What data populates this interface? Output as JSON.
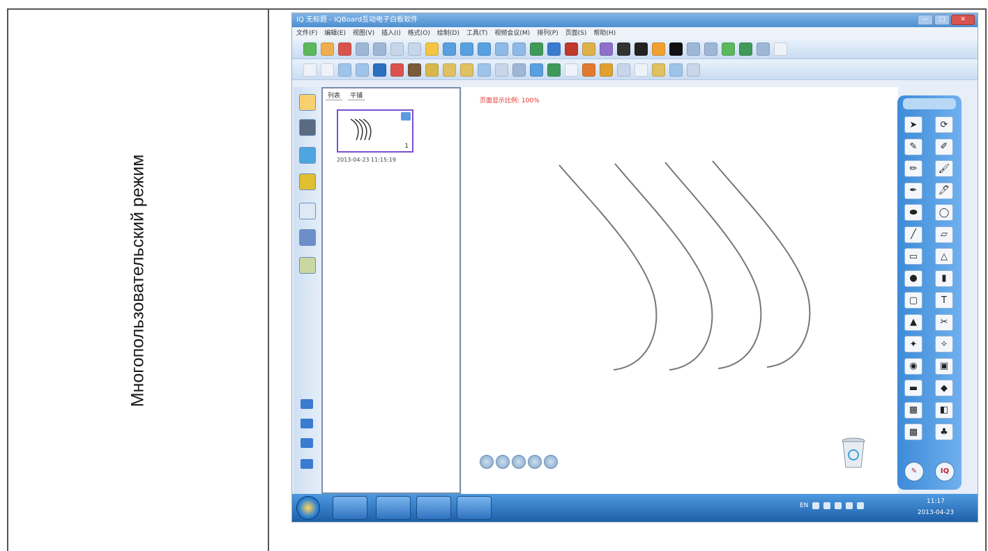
{
  "left_cell": {
    "label": "Многопользовательский режим"
  },
  "app": {
    "title": "IQ 无标题 - IQBoard互动电子白板软件",
    "menu": [
      "文件(F)",
      "编辑(E)",
      "视图(V)",
      "插入(I)",
      "格式(O)",
      "绘制(D)",
      "工具(T)",
      "视频会议(M)",
      "排列(P)",
      "页面(S)",
      "帮助(H)"
    ],
    "window_buttons": [
      "—",
      "□",
      "✕"
    ]
  },
  "pages_panel": {
    "tabs": [
      "列表",
      "平铺"
    ],
    "thumbnail": {
      "page_number": "1",
      "date": "2013-04-23 11:15:19"
    }
  },
  "canvas": {
    "zoom_text": "页面显示比例: 100%"
  },
  "palette": {
    "cells": [
      "➤",
      "⟳",
      "✎",
      "✐",
      "✏",
      "🖌",
      "✒",
      "🖊",
      "⬬",
      "◯",
      "╱",
      "▱",
      "▭",
      "△",
      "●",
      "▮",
      "▢",
      "T",
      "▲",
      "✂",
      "✦",
      "✧",
      "◉",
      "▣",
      "▬",
      "◆",
      "▦",
      "◧",
      "▩",
      "♣"
    ],
    "bottom": [
      "✎",
      "IQ"
    ]
  },
  "taskbar": {
    "clock_time": "11:17",
    "clock_date": "2013-04-23",
    "lang": "EN"
  },
  "colors": {
    "accent": "#3d8bd8",
    "frame": "#555555",
    "zoom_text": "#e0302a",
    "thumb_border": "#7b4fd1"
  }
}
